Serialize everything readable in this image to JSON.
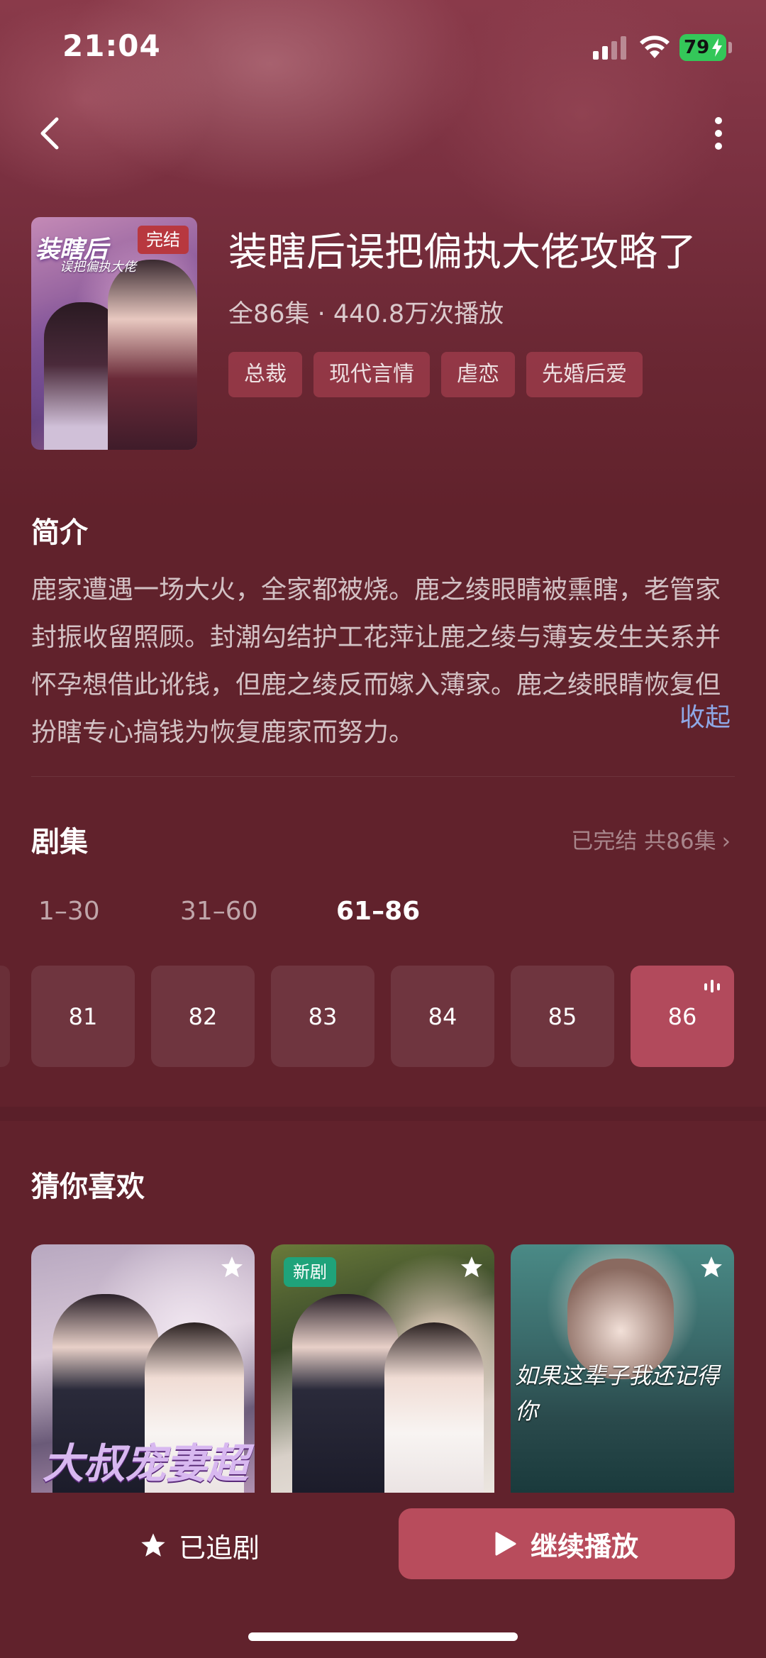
{
  "status_bar": {
    "time": "21:04",
    "battery": "79"
  },
  "drama": {
    "poster_title": "装瞎后",
    "poster_subtitle": "误把偏执大佬",
    "status_badge": "完结",
    "title": "装瞎后误把偏执大佬攻略了",
    "meta": "全86集 · 440.8万次播放",
    "tags": [
      "总裁",
      "现代言情",
      "虐恋",
      "先婚后爱"
    ]
  },
  "synopsis": {
    "heading": "简介",
    "text": "鹿家遭遇一场大火，全家都被烧。鹿之绫眼睛被熏瞎，老管家封振收留照顾。封潮勾结护工花萍让鹿之绫与薄妄发生关系并怀孕想借此讹钱，但鹿之绫反而嫁入薄家。鹿之绫眼睛恢复但扮瞎专心搞钱为恢复鹿家而努力。",
    "collapse_label": "收起"
  },
  "episodes": {
    "heading": "剧集",
    "status": "已完结 共86集",
    "ranges": [
      "1–30",
      "31–60",
      "61–86"
    ],
    "active_range": 2,
    "items": [
      "81",
      "82",
      "83",
      "84",
      "85",
      "86"
    ],
    "playing": "86"
  },
  "recommend": {
    "heading": "猜你喜欢",
    "cards": [
      {
        "poster_text": "大叔宠妻超甜",
        "badge": ""
      },
      {
        "poster_text": "",
        "badge": "新剧"
      },
      {
        "poster_text": "如果这辈子我还记得你",
        "badge": ""
      }
    ]
  },
  "bottom": {
    "follow_label": "已追剧",
    "play_label": "继续播放"
  },
  "colors": {
    "background": "#61222c",
    "accent": "#b84c5c",
    "link": "#8ea8e6",
    "new_badge": "#1fa37a",
    "done_badge": "#b8383f"
  }
}
